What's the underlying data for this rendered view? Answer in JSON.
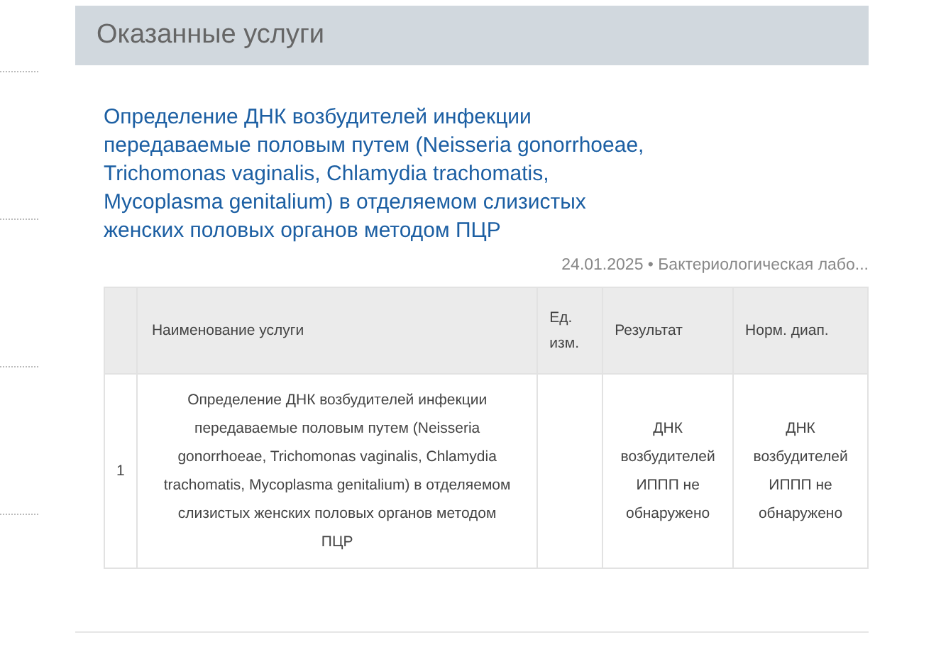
{
  "section": {
    "title": "Оказанные услуги"
  },
  "service": {
    "title": "Определение ДНК возбудителей инфекции передаваемые половым путем (Neisseria gonorrhoeae, Trichomonas vaginalis, Chlamydia trachomatis, Mycoplasma genitalium) в отделяемом слизистых женских половых органов методом ПЦР",
    "meta": "24.01.2025 • Бактериологическая лабо..."
  },
  "table": {
    "columns": [
      "",
      "Наименование услуги",
      "Ед. изм.",
      "Результат",
      "Норм. диап."
    ],
    "rows": [
      [
        "1",
        "Определение ДНК возбудителей инфекции передаваемые половым путем (Neisseria gonorrhoeae, Trichomonas vaginalis, Chlamydia trachomatis, Mycoplasma genitalium) в отделяемом слизистых женских половых органов методом ПЦР",
        "",
        "ДНК возбудителей ИППП не обнаружено",
        "ДНК возбудителей ИППП не обнаружено"
      ]
    ]
  }
}
